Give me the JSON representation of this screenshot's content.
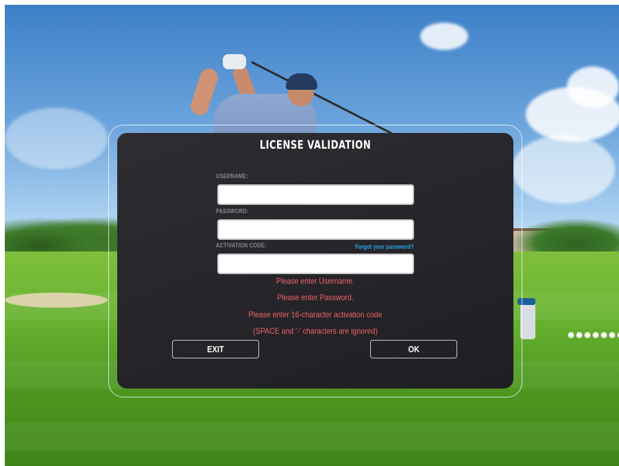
{
  "dialog": {
    "title": "LICENSE VALIDATION",
    "username": {
      "label": "USERNAME:",
      "value": "",
      "placeholder": ""
    },
    "password": {
      "label": "PASSWORD:",
      "value": "",
      "placeholder": ""
    },
    "activation_code": {
      "label": "ACTIVATION CODE:",
      "value": "",
      "placeholder": ""
    },
    "forgot_password_link": "Forgot your password?",
    "errors": [
      "Please enter Username.",
      "Please enter Password.",
      "Please enter 16-character activation code",
      "(SPACE and '-' characters are ignored)"
    ],
    "buttons": {
      "exit": "EXIT",
      "ok": "OK"
    }
  },
  "colors": {
    "dialog_background": "#252428",
    "error_text": "#f0636a",
    "link_text": "#2aa3e6",
    "label_text": "#8a8a8e"
  }
}
